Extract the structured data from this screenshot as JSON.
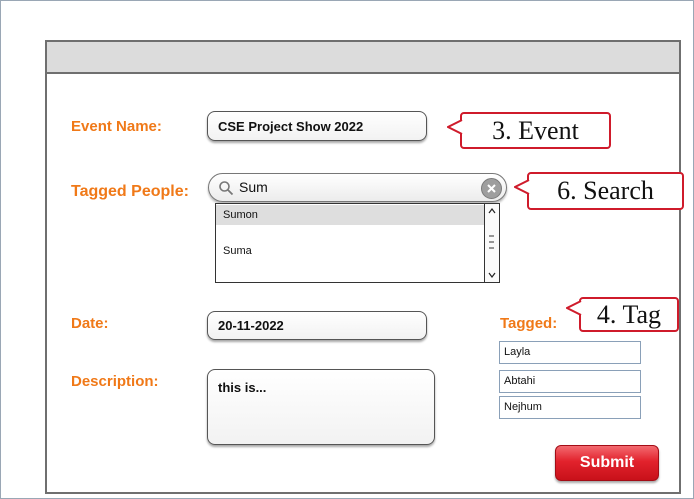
{
  "form": {
    "event_name_label": "Event Name:",
    "event_name_value": "CSE Project Show 2022",
    "tagged_people_label": "Tagged People:",
    "search_value": "Sum",
    "suggestions": [
      "Sumon",
      "Suma"
    ],
    "date_label": "Date:",
    "date_value": "20-11-2022",
    "description_label": "Description:",
    "description_value": "this is...",
    "tagged_label": "Tagged:",
    "tagged_people": [
      "Layla",
      "Abtahi",
      "Nejhum"
    ],
    "submit_label": "Submit"
  },
  "callouts": {
    "event": "3. Event",
    "search": "6. Search",
    "tag": "4. Tag"
  },
  "icons": {
    "search": "search-icon",
    "clear": "close-circle-icon",
    "scroll_up": "chevron-up-icon",
    "scroll_down": "chevron-down-icon"
  },
  "colors": {
    "label_orange": "#f07918",
    "submit_red": "#e2222c",
    "callout_border": "#cf1b2b"
  }
}
